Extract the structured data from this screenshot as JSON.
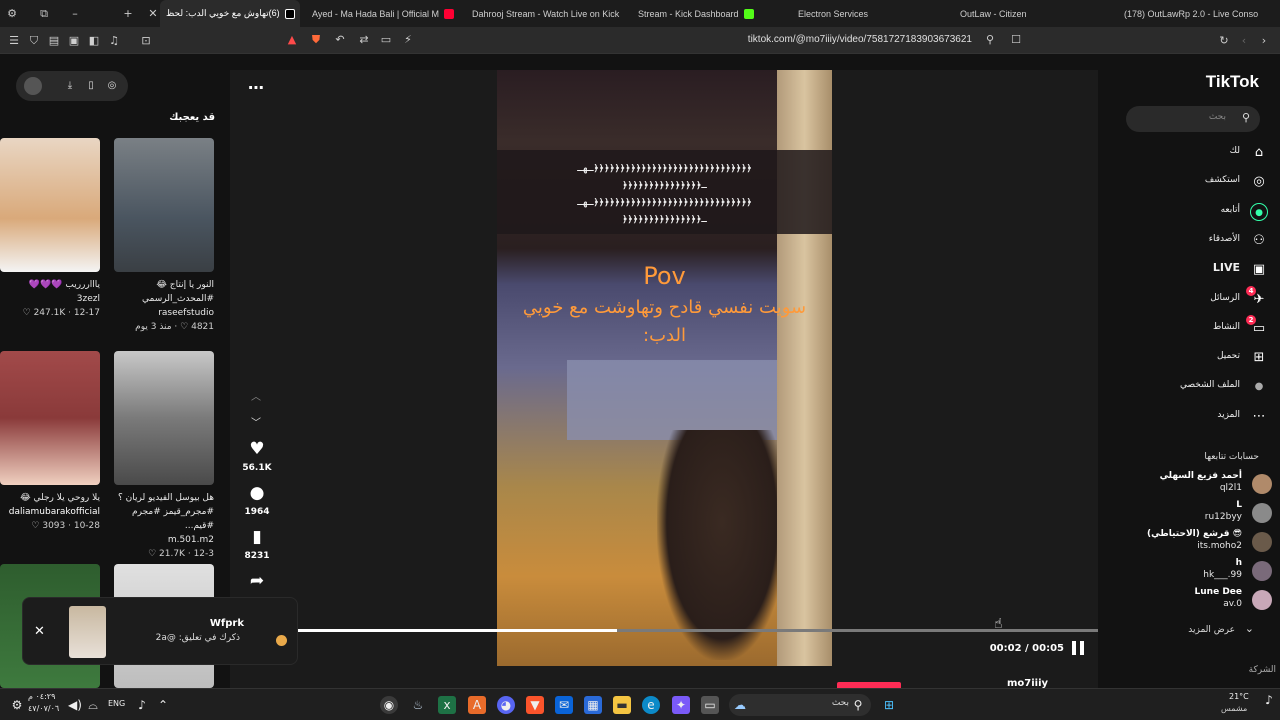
{
  "browser": {
    "tabs": [
      {
        "label": "(6)تهاوش مع خويي الدب: لحظ",
        "active": true,
        "favicon": "tiktok-icon"
      },
      {
        "label": "Ayed - Ma Hada Bali | Official M",
        "active": false,
        "favicon": "youtube-icon"
      },
      {
        "label": "Dahrooj Stream - Watch Live on Kick",
        "active": false,
        "favicon": "kick-icon"
      },
      {
        "label": "Stream - Kick Dashboard",
        "active": false,
        "favicon": "kick-icon"
      },
      {
        "label": "Electron Services",
        "active": false,
        "favicon": "kick-icon"
      },
      {
        "label": "OutLaw - Citizen",
        "active": false,
        "favicon": "gear-icon"
      },
      {
        "label": "(178) OutLawRp 2.0 - Live Console",
        "active": false,
        "favicon": "pen-icon"
      }
    ],
    "url": "tiktok.com/@mo7iiiy/video/7581727183903673621",
    "shield_badge_1": "1",
    "shield_badge_2": "7"
  },
  "left": {
    "suggestions_title": "قد يعجبك",
    "cards": [
      {
        "title": "ياااررريب 💜💜💜",
        "author": "3zezl",
        "meta": "12-17 · 247.1K ♡",
        "color": "#d9a97a"
      },
      {
        "title": "النور يا إنتاج 😂 #المحدث_الرسمي",
        "author": "raseefstudio",
        "meta": "4821 ♡ · منذ 3 يوم",
        "color": "#4a5560"
      },
      {
        "title": "يلا روحي يلا رجلي 😂",
        "author": "daliamubarakofficial",
        "meta": "10-28 · 3093 ♡",
        "color": "#8a3a3a"
      },
      {
        "title": "هل بيوسل الفيديو لريان ؟ #مجرم_قيمز #مجرم #قيم...",
        "author": "m.501.m2",
        "meta": "12-3 · 21.7K ♡",
        "color": "#9a9a9a"
      }
    ]
  },
  "video": {
    "caption_line1": "ـهـ﴿﴿﴿﴿﴿﴿﴿﴿﴿﴿﴿﴿﴿﴿﴿﴿﴿﴿﴿﴿﴿﴿﴿﴿﴿﴿﴿﴿﴿﴿",
    "caption_line2": "﴿﴿﴿﴿﴿﴿﴿﴿﴿﴿﴿﴿﴿﴿﴿ـ",
    "caption_line3": "ـهـ﴿﴿﴿﴿﴿﴿﴿﴿﴿﴿﴿﴿﴿﴿﴿﴿﴿﴿﴿﴿﴿﴿﴿﴿﴿﴿﴿﴿﴿﴿",
    "caption_line4": "﴿﴿﴿﴿﴿﴿﴿﴿﴿﴿﴿﴿﴿﴿﴿ـ",
    "pov": "Pov",
    "overlay_text": "سويت نفسي قادح وتهاوشت مع خويي الدب:",
    "likes": "56.1K",
    "comments": "1964",
    "saves": "8231",
    "time": "00:02 / 00:05",
    "progress": 0.4,
    "bottom_user": "mo7iiiy"
  },
  "toast": {
    "user": "Wfprk",
    "message": "ذكرك في تعليق: @2a"
  },
  "right": {
    "logo": "TikTok",
    "search_placeholder": "بحث",
    "nav": [
      {
        "label": "لك",
        "icon": "home-icon",
        "glyph": "⌂",
        "badge": ""
      },
      {
        "label": "استكشف",
        "icon": "compass-icon",
        "glyph": "◎",
        "badge": ""
      },
      {
        "label": "أتابعه",
        "icon": "following-avatar-icon",
        "glyph": "●",
        "badge": ""
      },
      {
        "label": "الأصدقاء",
        "icon": "friends-icon",
        "glyph": "⚇",
        "badge": ""
      },
      {
        "label": "LIVE",
        "icon": "live-icon",
        "glyph": "▣",
        "badge": "",
        "strong": true
      },
      {
        "label": "الرسائل",
        "icon": "messages-icon",
        "glyph": "✈",
        "badge": "4"
      },
      {
        "label": "النشاط",
        "icon": "activity-icon",
        "glyph": "▭",
        "badge": "2"
      },
      {
        "label": "تحميل",
        "icon": "upload-icon",
        "glyph": "⊞",
        "badge": ""
      },
      {
        "label": "الملف الشخصي",
        "icon": "profile-icon",
        "glyph": "●",
        "badge": ""
      },
      {
        "label": "المزيد",
        "icon": "more-icon",
        "glyph": "⋯",
        "badge": ""
      }
    ],
    "following_title": "حسابات تتابعها",
    "accounts": [
      {
        "name": "أحمد فزيع السهلي",
        "handle": "ql2l1",
        "color": "#b08a6a"
      },
      {
        "name": "L",
        "handle": "ru12byy",
        "color": "#8a8a8a"
      },
      {
        "name": "😎 قرشع (الاحتياطي)",
        "handle": "its.moho2",
        "color": "#6a5a4a"
      },
      {
        "name": "h",
        "handle": "hk___.99",
        "color": "#7a6a7a"
      },
      {
        "name": "Lune Dee",
        "handle": "av.0",
        "color": "#c8a8b8"
      }
    ],
    "show_more": "عرض المزيد",
    "company": "الشركة"
  },
  "taskbar": {
    "time": "٠٤:٢٩ م",
    "date": "٤٧/٠٧/٠٦",
    "lang": "ENG",
    "search": "بحث",
    "temp": "21°C",
    "weather": "مشمس"
  }
}
